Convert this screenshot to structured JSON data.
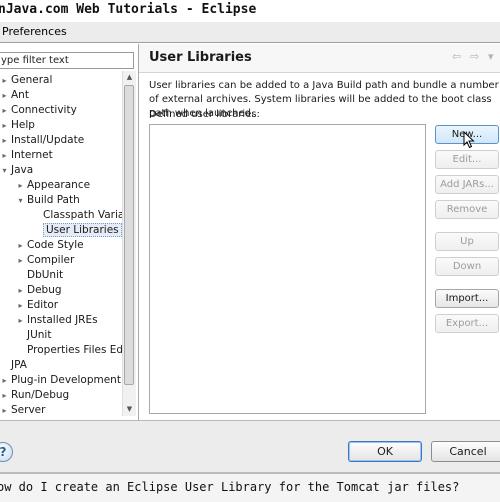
{
  "window": {
    "title": "nJava.com Web Tutorials - Eclipse"
  },
  "dialog": {
    "title": "Preferences"
  },
  "sidebar": {
    "filter": {
      "value": "ype filter text",
      "placeholder": "ype filter text"
    },
    "nodes": [
      {
        "label": "General",
        "twisty": "▸"
      },
      {
        "label": "Ant",
        "twisty": "▸"
      },
      {
        "label": "Connectivity",
        "twisty": "▸"
      },
      {
        "label": "Help",
        "twisty": "▸"
      },
      {
        "label": "Install/Update",
        "twisty": "▸"
      },
      {
        "label": "Internet",
        "twisty": "▸"
      },
      {
        "label": "Java",
        "twisty": "▾"
      },
      {
        "label": "Appearance",
        "twisty": "▸"
      },
      {
        "label": "Build Path",
        "twisty": "▾"
      },
      {
        "label": "Classpath Variable",
        "twisty": ""
      },
      {
        "label": "User Libraries",
        "twisty": ""
      },
      {
        "label": "Code Style",
        "twisty": "▸"
      },
      {
        "label": "Compiler",
        "twisty": "▸"
      },
      {
        "label": "DbUnit",
        "twisty": ""
      },
      {
        "label": "Debug",
        "twisty": "▸"
      },
      {
        "label": "Editor",
        "twisty": "▸"
      },
      {
        "label": "Installed JREs",
        "twisty": "▸"
      },
      {
        "label": "JUnit",
        "twisty": ""
      },
      {
        "label": "Properties Files Editor",
        "twisty": ""
      },
      {
        "label": "JPA",
        "twisty": ""
      },
      {
        "label": "Plug-in Development",
        "twisty": "▸"
      },
      {
        "label": "Run/Debug",
        "twisty": "▸"
      },
      {
        "label": "Server",
        "twisty": "▸"
      }
    ],
    "selected": "User Libraries",
    "scroll_up": "▲",
    "scroll_down": "▼"
  },
  "page": {
    "title": "User Libraries",
    "back_arrow": "⇦",
    "forward_arrow": "⇨",
    "menu_arrow": "▾",
    "description": "User libraries can be added to a Java Build path and bundle a number of external archives. System libraries will be added to the boot class path when launched.",
    "list_label": "Defined user libraries:"
  },
  "buttons": {
    "new": "New...",
    "edit": "Edit...",
    "add_jars": "Add JARs...",
    "remove": "Remove",
    "up": "Up",
    "down": "Down",
    "import": "Import...",
    "export": "Export..."
  },
  "footer": {
    "help": "?",
    "ok": "OK",
    "cancel": "Cancel"
  },
  "caption": {
    "text": "ow do I create an Eclipse User Library for the Tomcat jar files?"
  },
  "icons": {
    "cursor": "mouse-pointer-icon"
  },
  "colors": {
    "selection": "#e3ecf7",
    "default_button_border": "#3b78c4"
  }
}
